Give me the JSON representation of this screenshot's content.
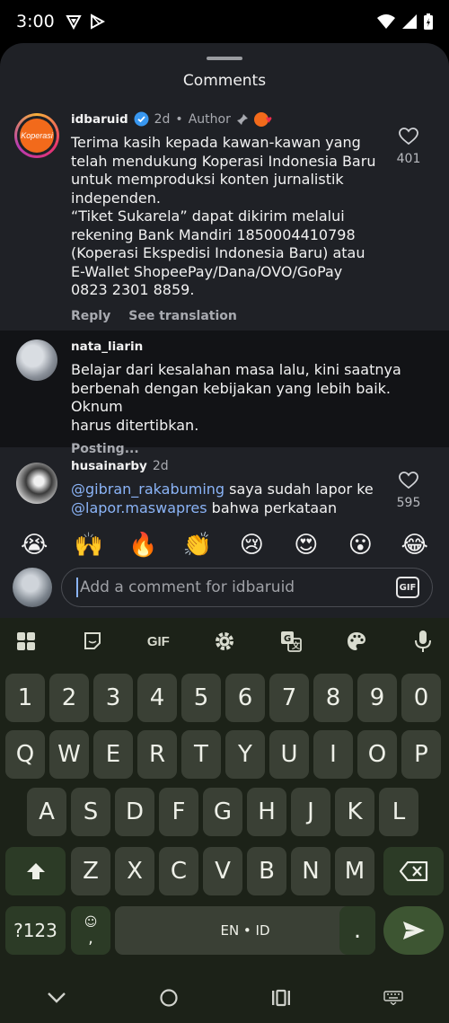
{
  "status": {
    "time": "3:00"
  },
  "sheet": {
    "title": "Comments"
  },
  "comments": [
    {
      "username": "idbaruid",
      "time": "2d",
      "author_label": "Author",
      "text": "Terima kasih kepada kawan-kawan yang\ntelah mendukung Koperasi Indonesia Baru\nuntuk memproduksi konten jurnalistik\nindependen.\n“Tiket Sukarela” dapat dikirim melalui\nrekening Bank Mandiri 1850004410798\n(Koperasi Ekspedisi Indonesia Baru) atau\nE-Wallet ShopeePay/Dana/OVO/GoPay\n0823 2301 8859.",
      "reply_label": "Reply",
      "translate_label": "See translation",
      "likes": "401"
    },
    {
      "username": "nata_liarin",
      "text": "Belajar dari kesalahan masa lalu, kini saatnya\nberbenah dengan kebijakan yang lebih baik. Oknum\nharus ditertibkan.",
      "status": "Posting..."
    },
    {
      "username": "husainarby",
      "time": "2d",
      "mention1": "@gibran_rakabuming",
      "text1": " saya sudah lapor ke",
      "mention2": "@lapor.maswapres",
      "text2": " bahwa perkataan",
      "likes": "595"
    }
  ],
  "emojis": [
    "😭",
    "🙌",
    "🔥",
    "👏",
    "😢",
    "😍",
    "😮",
    "😂"
  ],
  "input": {
    "placeholder": "Add a comment for idbaruid",
    "gif_label": "GIF"
  },
  "keyboard": {
    "toolbar_gif": "GIF",
    "row_numbers": [
      "1",
      "2",
      "3",
      "4",
      "5",
      "6",
      "7",
      "8",
      "9",
      "0"
    ],
    "row_q": [
      "Q",
      "W",
      "E",
      "R",
      "T",
      "Y",
      "U",
      "I",
      "O",
      "P"
    ],
    "row_a": [
      "A",
      "S",
      "D",
      "F",
      "G",
      "H",
      "J",
      "K",
      "L"
    ],
    "row_z": [
      "Z",
      "X",
      "C",
      "V",
      "B",
      "N",
      "M"
    ],
    "sym_label": "?123",
    "comma_label": ",",
    "space_label": "EN • ID",
    "period_label": "."
  }
}
